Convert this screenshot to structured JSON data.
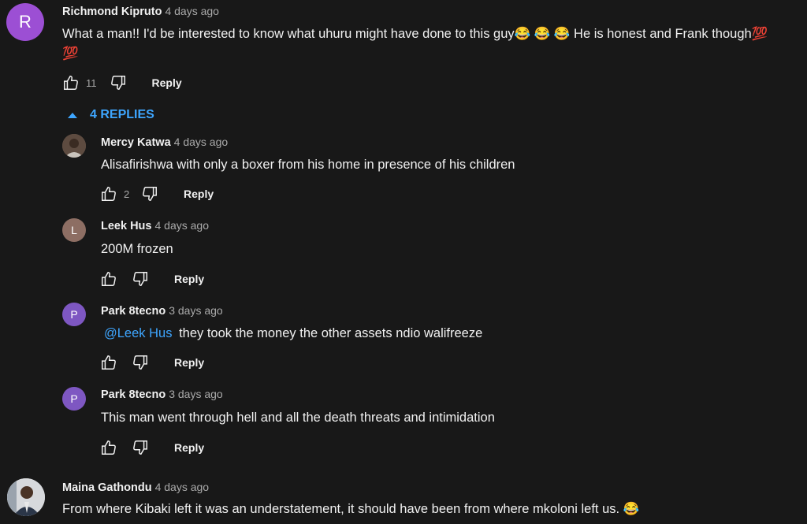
{
  "comments": [
    {
      "author": "Richmond Kipruto",
      "time": "4 days ago",
      "avatar_letter": "R",
      "avatar_color": "#9c4fd4",
      "text_line1": "What a man!! I'd be interested to know what uhuru might have done to this guy😂 😂 😂 He is honest and Frank though💯",
      "text_line2": "💯",
      "likes": "11",
      "reply_label": "Reply"
    }
  ],
  "replies_toggle": {
    "label": "4 REPLIES"
  },
  "replies": [
    {
      "author": "Mercy Katwa",
      "time": "4 days ago",
      "avatar_icon": "profile-photo",
      "text": "Alisafirishwa with only a boxer from his home in presence of his children",
      "likes": "2",
      "reply_label": "Reply"
    },
    {
      "author": "Leek Hus",
      "time": "4 days ago",
      "avatar_letter": "L",
      "avatar_color": "#8d6e63",
      "text": "200M frozen",
      "likes": "",
      "reply_label": "Reply"
    },
    {
      "author": "Park 8tecno",
      "time": "3 days ago",
      "avatar_letter": "P",
      "avatar_color": "#7e57c2",
      "mention": "@Leek Hus",
      "text": "they took the money the other assets ndio walifreeze",
      "likes": "",
      "reply_label": "Reply"
    },
    {
      "author": "Park 8tecno",
      "time": "3 days ago",
      "avatar_letter": "P",
      "avatar_color": "#7e57c2",
      "text": "This man went through hell and all the death threats and intimidation",
      "likes": "",
      "reply_label": "Reply"
    }
  ],
  "last_comment": {
    "author": "Maina Gathondu",
    "time": "4 days ago",
    "avatar_icon": "profile-photo",
    "text": "From where Kibaki left it was an understatement, it should have been from where mkoloni left us. 😂"
  },
  "colors": {
    "background": "#181818",
    "link": "#3ea6ff",
    "secondary_text": "#aaaaaa"
  }
}
